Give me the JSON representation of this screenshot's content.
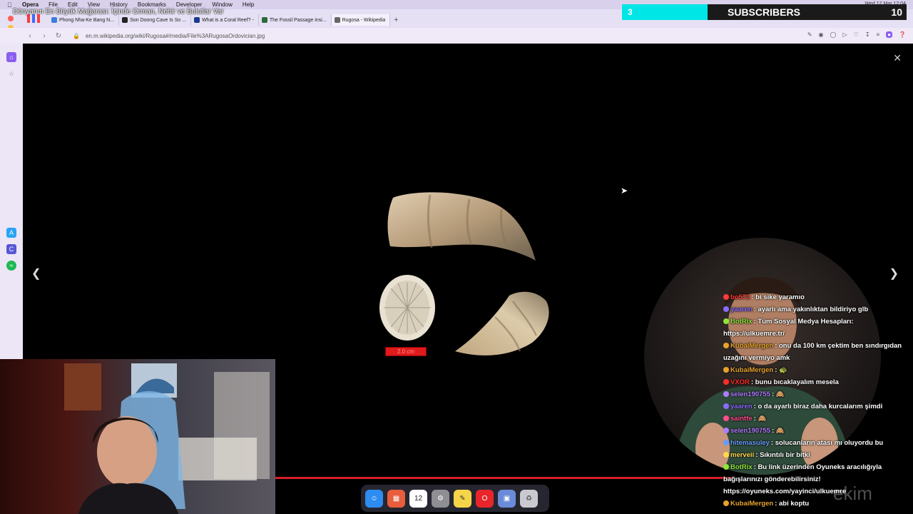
{
  "menubar": {
    "app": "Opera",
    "items": [
      "File",
      "Edit",
      "View",
      "History",
      "Bookmarks",
      "Developer",
      "Window",
      "Help"
    ],
    "clock": "Wed 12 Mar 12:04"
  },
  "overlay_title": "Dünyanın En Büyük Mağarası: İçinde Orman, Nehir ve Bulutlar Var",
  "tabs": [
    {
      "label": "Phong Nha-Ke Bang N...",
      "color": "#3b7ddd"
    },
    {
      "label": "Son Doong Cave Is So ...",
      "color": "#222222"
    },
    {
      "label": "What is a Coral Reef? -",
      "color": "#1a3a8a"
    },
    {
      "label": "The Fossil Passage insi...",
      "color": "#2a6a3a"
    },
    {
      "label": "Rugosa - Wikipedia",
      "color": "#666666"
    }
  ],
  "address": {
    "url": "en.m.wikipedia.org/wiki/Rugosa#/media/File%3ARugosaOrdovician.jpg"
  },
  "viewer": {
    "scale_label": "2.0 cm"
  },
  "subscribers": {
    "count": "3",
    "label": "SUBSCRIBERS",
    "goal": "10",
    "progress": 0.3
  },
  "chat": [
    {
      "user": "bo572",
      "text": "bi sike yaramıo",
      "color": "#ff3b3b"
    },
    {
      "user": "yaaren",
      "text": "ayarlı ama yakınlıktan bildiriyo glb",
      "color": "#8a6cff"
    },
    {
      "user": "BotRix",
      "text": "Tüm Sosyal Medya Hesapları: https://ulkuemre.tr/",
      "color": "#8fe53b"
    },
    {
      "user": "KubaiMergen",
      "text": "onu da 100 km çektim ben sındırgıdan uzağını vermiyo amk",
      "color": "#e8a32b"
    },
    {
      "user": "KubaiMergen",
      "text": "🐢",
      "color": "#e8a32b"
    },
    {
      "user": "VXOR",
      "text": "bunu bıcaklayalım mesela",
      "color": "#ff2b2b"
    },
    {
      "user": "selen190755",
      "text": "🙈",
      "color": "#b07cff"
    },
    {
      "user": "yaaren",
      "text": "o da ayarlı biraz daha kurcalarım şimdi",
      "color": "#8a6cff"
    },
    {
      "user": "saintfe",
      "text": "🙈",
      "color": "#ff4d8d"
    },
    {
      "user": "selen190755",
      "text": "🙈",
      "color": "#b07cff"
    },
    {
      "user": "hitemasuley",
      "text": "solucanların atası mı oluyordu bu",
      "color": "#6a9bff"
    },
    {
      "user": "merveii",
      "text": "Sıkıntılı bir bitki",
      "color": "#ffd84a"
    },
    {
      "user": "BotRix",
      "text": "Bu link üzerinden Oyuneks aracılığıyla bağışlarınızı gönderebilirsiniz! https://oyuneks.com/yayinci/ulkuemre",
      "color": "#8fe53b"
    },
    {
      "user": "KubaiMergen",
      "text": "abi koptu",
      "color": "#e8a32b"
    }
  ],
  "dock": [
    {
      "name": "finder",
      "color": "#2d8cf0",
      "glyph": "☺"
    },
    {
      "name": "launchpad",
      "color": "#e85d3b",
      "glyph": "▦"
    },
    {
      "name": "calendar",
      "color": "#ffffff",
      "glyph": "12"
    },
    {
      "name": "settings",
      "color": "#8e8e93",
      "glyph": "⚙"
    },
    {
      "name": "notes",
      "color": "#f5d547",
      "glyph": "✎"
    },
    {
      "name": "opera",
      "color": "#e8252b",
      "glyph": "O"
    },
    {
      "name": "preview",
      "color": "#6a8bd8",
      "glyph": "▣"
    },
    {
      "name": "trash",
      "color": "#c9c9cf",
      "glyph": "🗑"
    }
  ],
  "watermark": "ekim"
}
